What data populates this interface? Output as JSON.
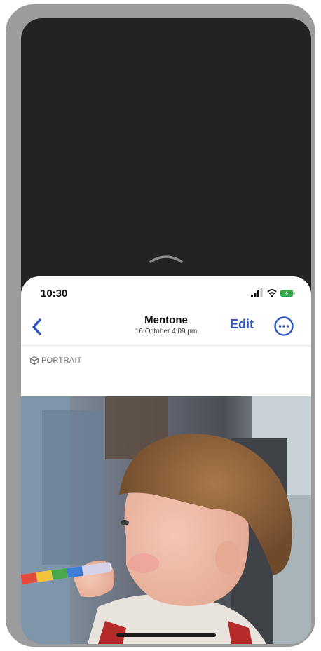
{
  "status_bar": {
    "time": "10:30"
  },
  "nav": {
    "title": "Mentone",
    "subtitle": "16 October  4:09 pm",
    "edit_label": "Edit"
  },
  "badge": {
    "label": "PORTRAIT"
  },
  "icons": {
    "back": "chevron-left-icon",
    "more": "ellipsis-circle-icon",
    "handle": "chevron-up-icon",
    "badge": "cube-icon",
    "signal": "signal-icon",
    "wifi": "wifi-icon",
    "battery": "battery-icon"
  },
  "colors": {
    "accent": "#2e55c0",
    "background": "#232323",
    "frame": "#9c9c9c"
  }
}
